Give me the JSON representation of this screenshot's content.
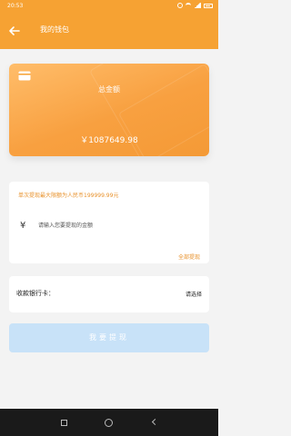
{
  "status_bar": {
    "time": "20:53",
    "icons": [
      "alarm-icon",
      "wifi-icon",
      "signal-icon",
      "battery-icon"
    ]
  },
  "header": {
    "title": "我的钱包",
    "back_icon": "arrow-left-icon"
  },
  "card": {
    "icon": "wallet-icon",
    "label": "总金额",
    "amount": "￥1087649.98"
  },
  "withdraw": {
    "limit_text": "单次提现最大限额为人民币199999.99元",
    "currency_symbol": "¥",
    "amount_placeholder": "请输入您要提现的金额",
    "all_label": "全部提现"
  },
  "bank": {
    "label": "收款银行卡：",
    "select_label": "请选择"
  },
  "submit_label": "我要提现",
  "navbar": {
    "icons": [
      "recent-apps-icon",
      "home-icon",
      "back-icon"
    ]
  },
  "colors": {
    "primary": "#f6a233",
    "accent_text": "#e8922c",
    "button_disabled": "#c8e2f8"
  }
}
